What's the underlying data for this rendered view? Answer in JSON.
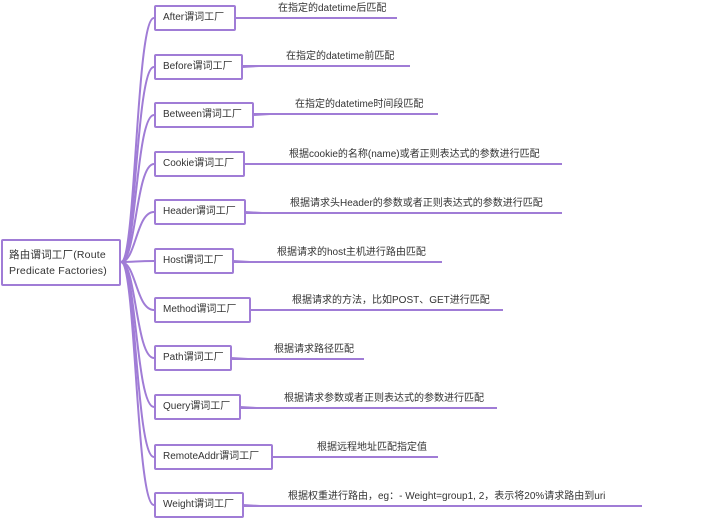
{
  "root": {
    "label": "路由谓词工厂(Route Predicate Factories)"
  },
  "branches": [
    {
      "label": "After谓词工厂",
      "desc": "在指定的datetime后匹配"
    },
    {
      "label": "Before谓词工厂",
      "desc": "在指定的datetime前匹配"
    },
    {
      "label": "Between谓词工厂",
      "desc": "在指定的datetime时间段匹配"
    },
    {
      "label": "Cookie谓词工厂",
      "desc": "根据cookie的名称(name)或者正则表达式的参数进行匹配"
    },
    {
      "label": "Header谓词工厂",
      "desc": "根据请求头Header的参数或者正则表达式的参数进行匹配"
    },
    {
      "label": "Host谓词工厂",
      "desc": "根据请求的host主机进行路由匹配"
    },
    {
      "label": "Method谓词工厂",
      "desc": "根据请求的方法，比如POST、GET进行匹配"
    },
    {
      "label": "Path谓词工厂",
      "desc": "根据请求路径匹配"
    },
    {
      "label": "Query谓词工厂",
      "desc": "根据请求参数或者正则表达式的参数进行匹配"
    },
    {
      "label": "RemoteAddr谓词工厂",
      "desc": "根据远程地址匹配指定值"
    },
    {
      "label": "Weight谓词工厂",
      "desc": "根据权重进行路由，eg：- Weight=group1, 2，表示将20%请求路由到uri"
    }
  ],
  "colors": {
    "line": "#a07cd6",
    "text": "#333333"
  }
}
